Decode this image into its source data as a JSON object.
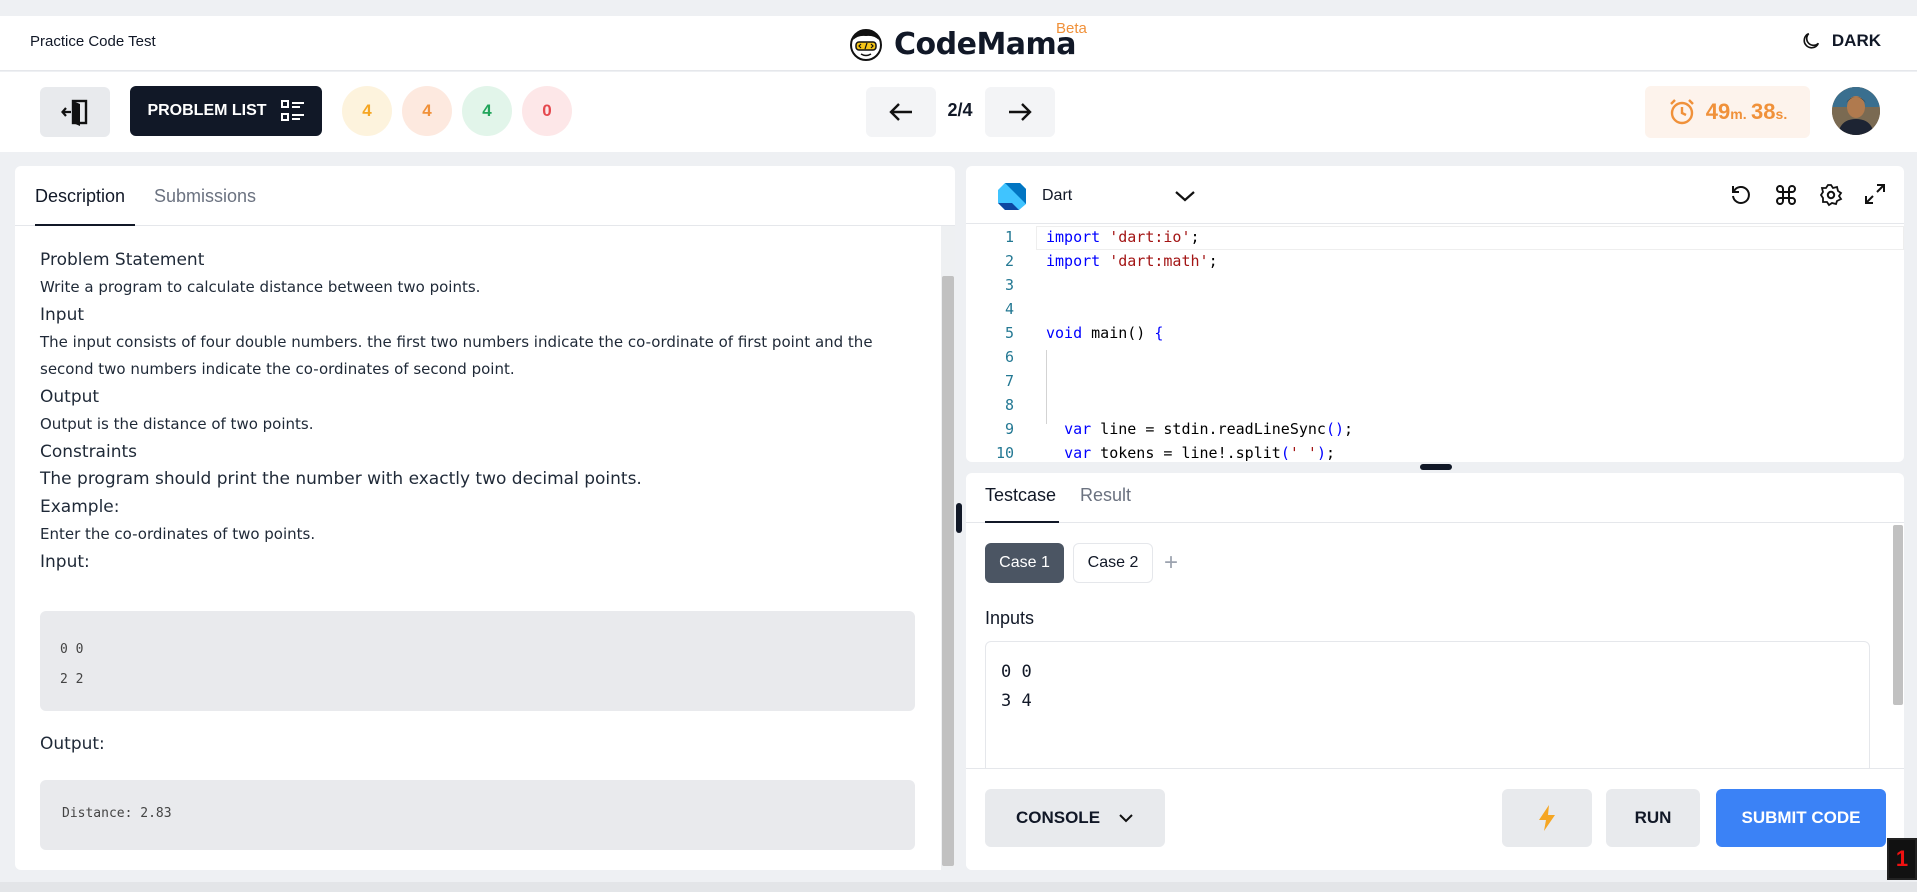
{
  "header": {
    "app_title": "Practice Code Test",
    "brand_name": "CodeMama",
    "brand_tag": "Beta",
    "theme_label": "DARK"
  },
  "toolbar": {
    "problem_list_label": "PROBLEM LIST",
    "badges": [
      {
        "value": "4",
        "color": "#f5a623",
        "bg": "#fdf3dd"
      },
      {
        "value": "4",
        "color": "#f0913a",
        "bg": "#fde9df"
      },
      {
        "value": "4",
        "color": "#22a55b",
        "bg": "#e2f5ea"
      },
      {
        "value": "0",
        "color": "#e5484d",
        "bg": "#fde7e8"
      }
    ],
    "page_indicator": "2/4",
    "timer": {
      "minutes": "49",
      "minutes_unit": "m.",
      "seconds": "38",
      "seconds_unit": "s."
    }
  },
  "left_panel": {
    "tabs": [
      "Description",
      "Submissions"
    ],
    "problem_statement_heading": "Problem Statement",
    "problem_statement_text": "Write a program to calculate distance between two points.",
    "input_heading": "Input",
    "input_text": "The input consists of four double numbers. the first two numbers indicate the co-ordinate of first point and the second two numbers indicate the co-ordinates of second point.",
    "output_heading": "Output",
    "output_text": "Output is the distance of two points.",
    "constraints_heading": "Constraints",
    "constraints_text": "The program should print the number with exactly two decimal points.",
    "example_heading": "Example:",
    "example_text": "Enter the co-ordinates of two points.",
    "example_input_label": "Input:",
    "example_input_lines": [
      "0 0",
      "2 2"
    ],
    "example_output_label": "Output:",
    "example_output_text": "Distance: 2.83"
  },
  "editor": {
    "language": "Dart",
    "tools": [
      "reset-icon",
      "command-icon",
      "settings-icon",
      "fullscreen-icon"
    ],
    "lines": [
      {
        "n": "1",
        "code": "import 'dart:io';"
      },
      {
        "n": "2",
        "code": "import 'dart:math';"
      },
      {
        "n": "3",
        "code": ""
      },
      {
        "n": "4",
        "code": ""
      },
      {
        "n": "5",
        "code": "void main() {"
      },
      {
        "n": "6",
        "code": ""
      },
      {
        "n": "7",
        "code": ""
      },
      {
        "n": "8",
        "code": ""
      },
      {
        "n": "9",
        "code": "  var line = stdin.readLineSync();"
      },
      {
        "n": "10",
        "code": "  var tokens = line!.split(' ');"
      }
    ]
  },
  "testcase_panel": {
    "tabs": [
      "Testcase",
      "Result"
    ],
    "cases": [
      "Case 1",
      "Case 2"
    ],
    "add_symbol": "+",
    "inputs_label": "Inputs",
    "input_lines": [
      "0 0",
      "3 4"
    ],
    "console_label": "CONSOLE",
    "run_label": "RUN",
    "submit_label": "SUBMIT CODE"
  },
  "corner_badge": "1",
  "colors": {
    "accent_blue": "#3b82f6",
    "dark": "#111827",
    "timer_orange": "#f0913a"
  }
}
